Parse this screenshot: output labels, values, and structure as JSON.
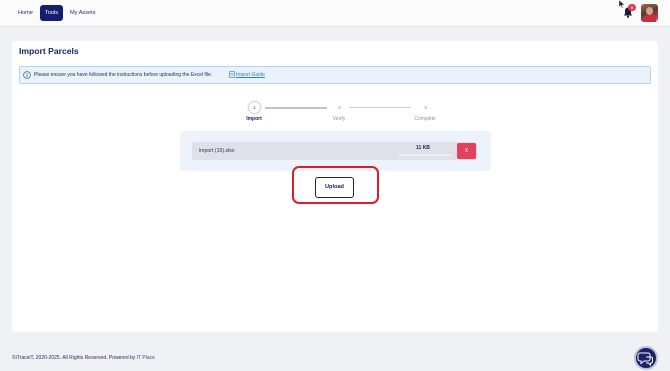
{
  "nav": {
    "items": [
      {
        "label": "Home",
        "active": false
      },
      {
        "label": "Tools",
        "active": true
      },
      {
        "label": "My Assets",
        "active": false
      }
    ],
    "notification_count": "0",
    "icons": {
      "bell": "bell-icon",
      "avatar": "user-avatar"
    }
  },
  "page": {
    "title": "Import Parcels",
    "info_text": "Please ensure you have followed the instructions before uploading the Excel file.",
    "guide_link": "Import Guide"
  },
  "stepper": {
    "steps": [
      {
        "number": "1",
        "label": "Import",
        "active": true
      },
      {
        "number": "2",
        "label": "Verify",
        "active": false
      },
      {
        "number": "3",
        "label": "Complete",
        "active": false
      }
    ]
  },
  "file": {
    "name": "import (15).xlsx",
    "size": "11 KB",
    "progress": 0,
    "remove_label": "X"
  },
  "upload": {
    "label": "Upload"
  },
  "footer": {
    "copyright": "©iTraceiT, 2020-2025. All Rights Reserved. Powered by",
    "brand": "IT Place"
  },
  "colors": {
    "primary": "#1b2266",
    "danger": "#e2415d",
    "highlight": "#d8202a",
    "link": "#2f7bd6"
  }
}
